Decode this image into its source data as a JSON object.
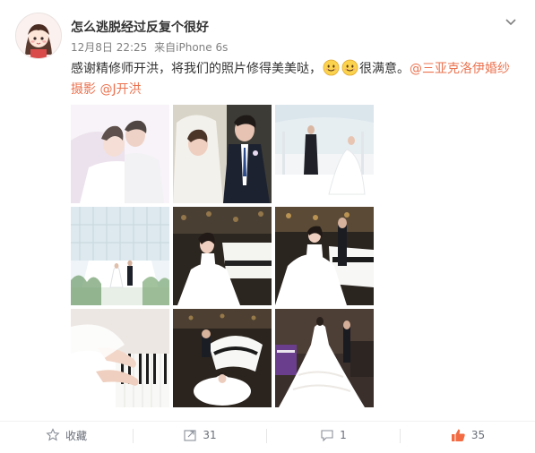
{
  "user": {
    "name": "怎么逃脱经过反复个很好"
  },
  "meta": {
    "time": "12月8日 22:25",
    "source_prefix": "来自",
    "source": "iPhone 6s"
  },
  "post": {
    "text_before": "感谢精修师开洪，将我们的照片修得美美哒，",
    "text_after": "很满意。",
    "mention1": "@三亚克洛伊婚纱",
    "mention1_line2": "摄影",
    "mention2": "@J开洪",
    "emoji": [
      "smile-face",
      "smile-face"
    ]
  },
  "photos": [
    {
      "scene": "couple-closeup-soft"
    },
    {
      "scene": "couple-veil-suit"
    },
    {
      "scene": "white-hall-standing"
    },
    {
      "scene": "glass-chapel"
    },
    {
      "scene": "bride-at-piano-dark"
    },
    {
      "scene": "couple-by-white-piano"
    },
    {
      "scene": "hands-on-keys"
    },
    {
      "scene": "piano-from-above"
    },
    {
      "scene": "bride-back-gown"
    }
  ],
  "actions": {
    "favorite": "收藏",
    "repost": "31",
    "comment": "1",
    "like": "35"
  },
  "colors": {
    "accent": "#eb7350",
    "text": "#333333",
    "meta": "#808080",
    "like": "#eb7350"
  }
}
